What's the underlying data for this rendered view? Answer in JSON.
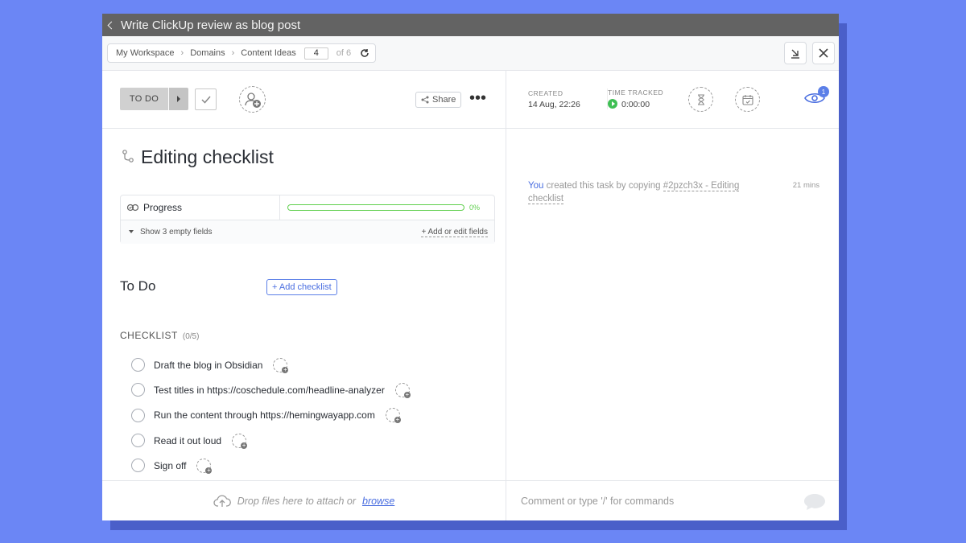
{
  "window": {
    "title": "Write ClickUp review as blog post"
  },
  "breadcrumb": {
    "items": [
      "My Workspace",
      "Domains",
      "Content Ideas"
    ],
    "current_index": "4",
    "total_label": "of 6"
  },
  "toolbar": {
    "status_label": "TO DO",
    "share_label": "Share"
  },
  "task": {
    "title": "Editing checklist"
  },
  "fields": {
    "progress_label": "Progress",
    "progress_pct": "0%",
    "progress_value": 0,
    "show_empty": "Show 3 empty fields",
    "add_edit": "+ Add or edit fields"
  },
  "todo": {
    "heading": "To Do",
    "add_checklist": "+ Add checklist"
  },
  "checklist": {
    "heading": "CHECKLIST",
    "count": "(0/5)",
    "items": [
      "Draft the blog in Obsidian",
      "Test titles in https://coschedule.com/headline-analyzer",
      "Run the content through https://hemingwayapp.com",
      "Read it out loud",
      "Sign off"
    ]
  },
  "meta": {
    "created_label": "CREATED",
    "created_value": "14 Aug, 22:26",
    "tracked_label": "TIME TRACKED",
    "tracked_value": "0:00:00",
    "watchers_count": "1"
  },
  "activity": {
    "actor": "You",
    "text": "created this task by copying",
    "link": "#2pzch3x - Editing checklist",
    "time": "21 mins"
  },
  "attach": {
    "text": "Drop files here to attach or",
    "browse": "browse"
  },
  "comment": {
    "placeholder": "Comment or type '/' for commands"
  },
  "colors": {
    "accent": "#5b7fe8",
    "progress": "#5fcf4d",
    "play": "#3fbf54",
    "background": "#6b86f5"
  }
}
